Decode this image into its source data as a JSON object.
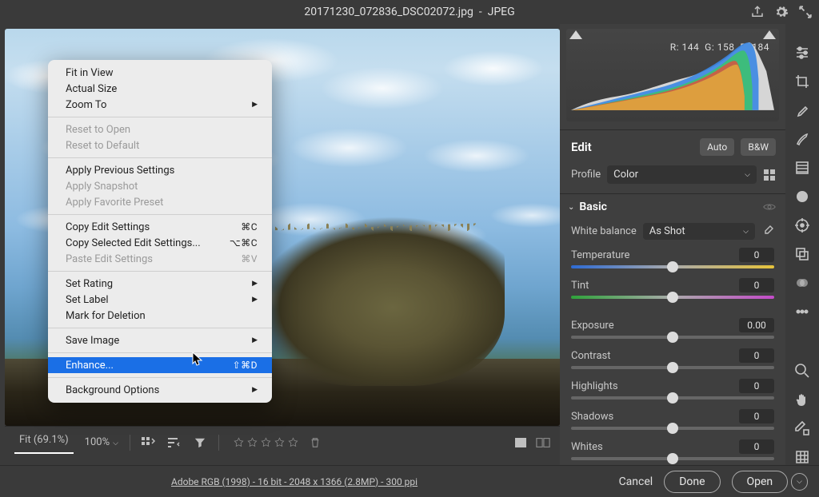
{
  "title_bar": {
    "filename": "20171230_072836_DSC02072.jpg",
    "format": "JPEG"
  },
  "histogram_readout": {
    "r": "R: 144",
    "g": "G: 158",
    "b": "B: 184"
  },
  "edit_panel": {
    "title": "Edit",
    "auto": "Auto",
    "bw": "B&W",
    "profile_label": "Profile",
    "profile_value": "Color",
    "basic_title": "Basic",
    "white_balance_label": "White balance",
    "white_balance_value": "As Shot",
    "sliders": {
      "temperature": {
        "label": "Temperature",
        "value": "0",
        "pos": 50,
        "track": "temp"
      },
      "tint": {
        "label": "Tint",
        "value": "0",
        "pos": 50,
        "track": "tint"
      },
      "exposure": {
        "label": "Exposure",
        "value": "0.00",
        "pos": 50,
        "track": "gray"
      },
      "contrast": {
        "label": "Contrast",
        "value": "0",
        "pos": 50,
        "track": "gray"
      },
      "highlights": {
        "label": "Highlights",
        "value": "0",
        "pos": 50,
        "track": "gray"
      },
      "shadows": {
        "label": "Shadows",
        "value": "0",
        "pos": 50,
        "track": "gray"
      },
      "whites": {
        "label": "Whites",
        "value": "0",
        "pos": 50,
        "track": "gray"
      }
    }
  },
  "context_menu": {
    "fit_in_view": "Fit in View",
    "actual_size": "Actual Size",
    "zoom_to": "Zoom To",
    "reset_to_open": "Reset to Open",
    "reset_to_default": "Reset to Default",
    "apply_previous": "Apply Previous Settings",
    "apply_snapshot": "Apply Snapshot",
    "apply_favorite": "Apply Favorite Preset",
    "copy_edit": "Copy Edit Settings",
    "copy_edit_sc": "⌘C",
    "copy_selected": "Copy Selected Edit Settings...",
    "copy_selected_sc": "⌥⌘C",
    "paste_edit": "Paste Edit Settings",
    "paste_edit_sc": "⌘V",
    "set_rating": "Set Rating",
    "set_label": "Set Label",
    "mark_delete": "Mark for Deletion",
    "save_image": "Save Image",
    "enhance": "Enhance...",
    "enhance_sc": "⇧⌘D",
    "background": "Background Options"
  },
  "toolbar": {
    "fit": "Fit (69.1%)",
    "zoom": "100%"
  },
  "footer": {
    "info": "Adobe RGB (1998) - 16 bit - 2048 x 1366 (2.8MP) - 300 ppi",
    "cancel": "Cancel",
    "done": "Done",
    "open": "Open"
  }
}
